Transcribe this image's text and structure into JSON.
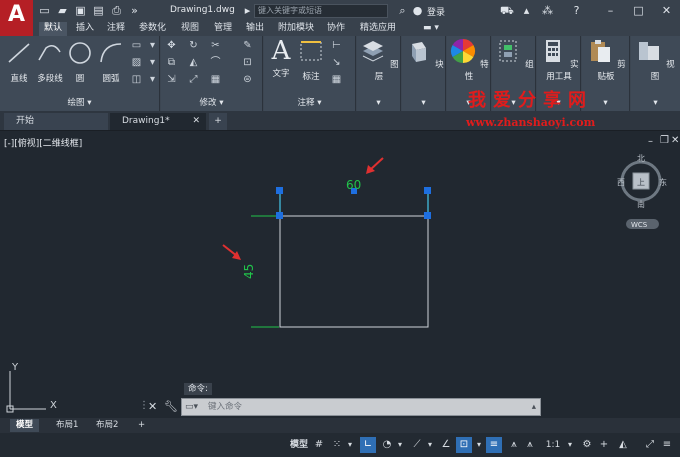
{
  "app": {
    "logo_letter": "A",
    "doc_title": "Drawing1.dwg",
    "search_placeholder": "键入关键字或短语",
    "login": "登录"
  },
  "ribbon_tabs": [
    "默认",
    "插入",
    "注释",
    "参数化",
    "视图",
    "管理",
    "输出",
    "附加模块",
    "协作",
    "精选应用"
  ],
  "panels": {
    "draw": {
      "title": "绘图",
      "tools": [
        "直线",
        "多段线",
        "圆",
        "圆弧"
      ]
    },
    "modify": {
      "title": "修改"
    },
    "annotation": {
      "title": "注释",
      "tools": [
        "文字",
        "标注"
      ]
    },
    "layers": {
      "label": "图层"
    },
    "block": {
      "label": "块"
    },
    "properties": {
      "label": "特性"
    },
    "groups": {
      "label": "组"
    },
    "utilities": {
      "label": "实用工具"
    },
    "clipboard": {
      "label": "剪贴板"
    },
    "view": {
      "label": "视图"
    }
  },
  "file_tabs": {
    "start": "开始",
    "doc": "Drawing1*",
    "add": "+"
  },
  "watermark": {
    "text": "我爱分享网",
    "url": "www.zhanshaoyi.com"
  },
  "viewport": {
    "label": "[-][俯视][二维线框]"
  },
  "dimensions": {
    "horizontal": "60",
    "vertical": "45"
  },
  "viewcube": {
    "north": "北",
    "south": "南",
    "west": "西",
    "east": "东",
    "face": "上",
    "wcs": "WCS"
  },
  "ucs": {
    "x": "X",
    "y": "Y"
  },
  "command": {
    "label": "命令:",
    "placeholder": "键入命令"
  },
  "layout_tabs": [
    "模型",
    "布局1",
    "布局2",
    "+"
  ],
  "status": {
    "model": "模型",
    "scale": "1:1"
  },
  "colors": {
    "accent": "#2f6fb5",
    "dimension": "#21c44a",
    "grip": "#1e6fe0",
    "watermark": "#e01c1c",
    "arrow": "#e03030"
  }
}
